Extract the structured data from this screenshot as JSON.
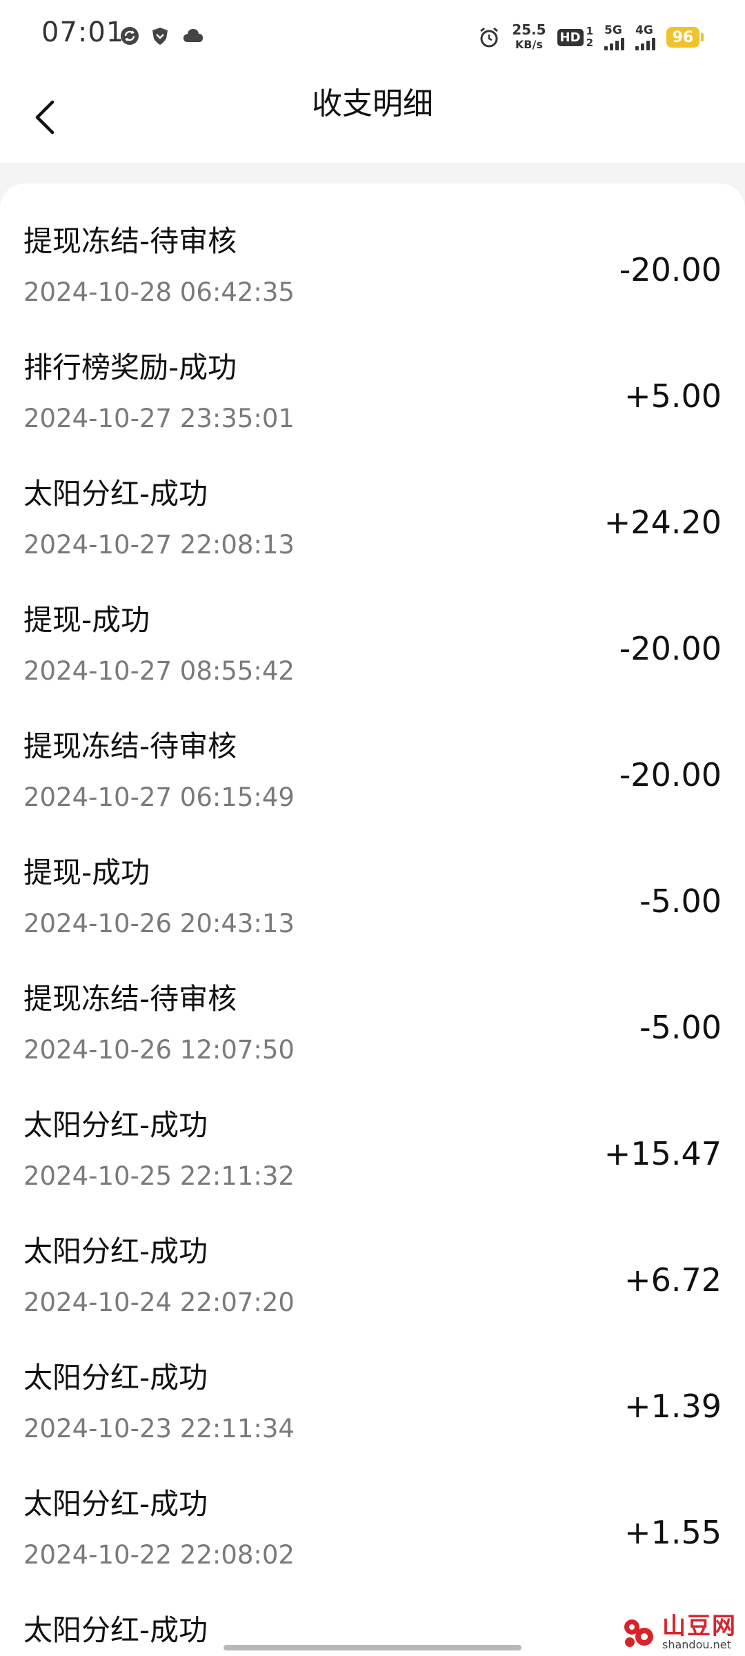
{
  "status_bar": {
    "time": "07:01",
    "net_speed_value": "25.5",
    "net_speed_unit": "KB/s",
    "hd_label": "HD",
    "sim1": "1",
    "sim2": "2",
    "net1": "5G",
    "net2": "4G",
    "battery": "96",
    "icons": [
      "sync-icon",
      "shield-icon",
      "cloud-icon",
      "alarm-icon"
    ]
  },
  "header": {
    "title": "收支明细"
  },
  "transactions": [
    {
      "title": "提现冻结-待审核",
      "time": "2024-10-28 06:42:35",
      "amount": "-20.00"
    },
    {
      "title": "排行榜奖励-成功",
      "time": "2024-10-27 23:35:01",
      "amount": "+5.00"
    },
    {
      "title": "太阳分红-成功",
      "time": "2024-10-27 22:08:13",
      "amount": "+24.20"
    },
    {
      "title": "提现-成功",
      "time": "2024-10-27 08:55:42",
      "amount": "-20.00"
    },
    {
      "title": "提现冻结-待审核",
      "time": "2024-10-27 06:15:49",
      "amount": "-20.00"
    },
    {
      "title": "提现-成功",
      "time": "2024-10-26 20:43:13",
      "amount": "-5.00"
    },
    {
      "title": "提现冻结-待审核",
      "time": "2024-10-26 12:07:50",
      "amount": "-5.00"
    },
    {
      "title": "太阳分红-成功",
      "time": "2024-10-25 22:11:32",
      "amount": "+15.47"
    },
    {
      "title": "太阳分红-成功",
      "time": "2024-10-24 22:07:20",
      "amount": "+6.72"
    },
    {
      "title": "太阳分红-成功",
      "time": "2024-10-23 22:11:34",
      "amount": "+1.39"
    },
    {
      "title": "太阳分红-成功",
      "time": "2024-10-22 22:08:02",
      "amount": "+1.55"
    },
    {
      "title": "太阳分红-成功",
      "time": "",
      "amount": ""
    }
  ],
  "watermark": {
    "cn": "山豆网",
    "en": "shandou.net"
  }
}
